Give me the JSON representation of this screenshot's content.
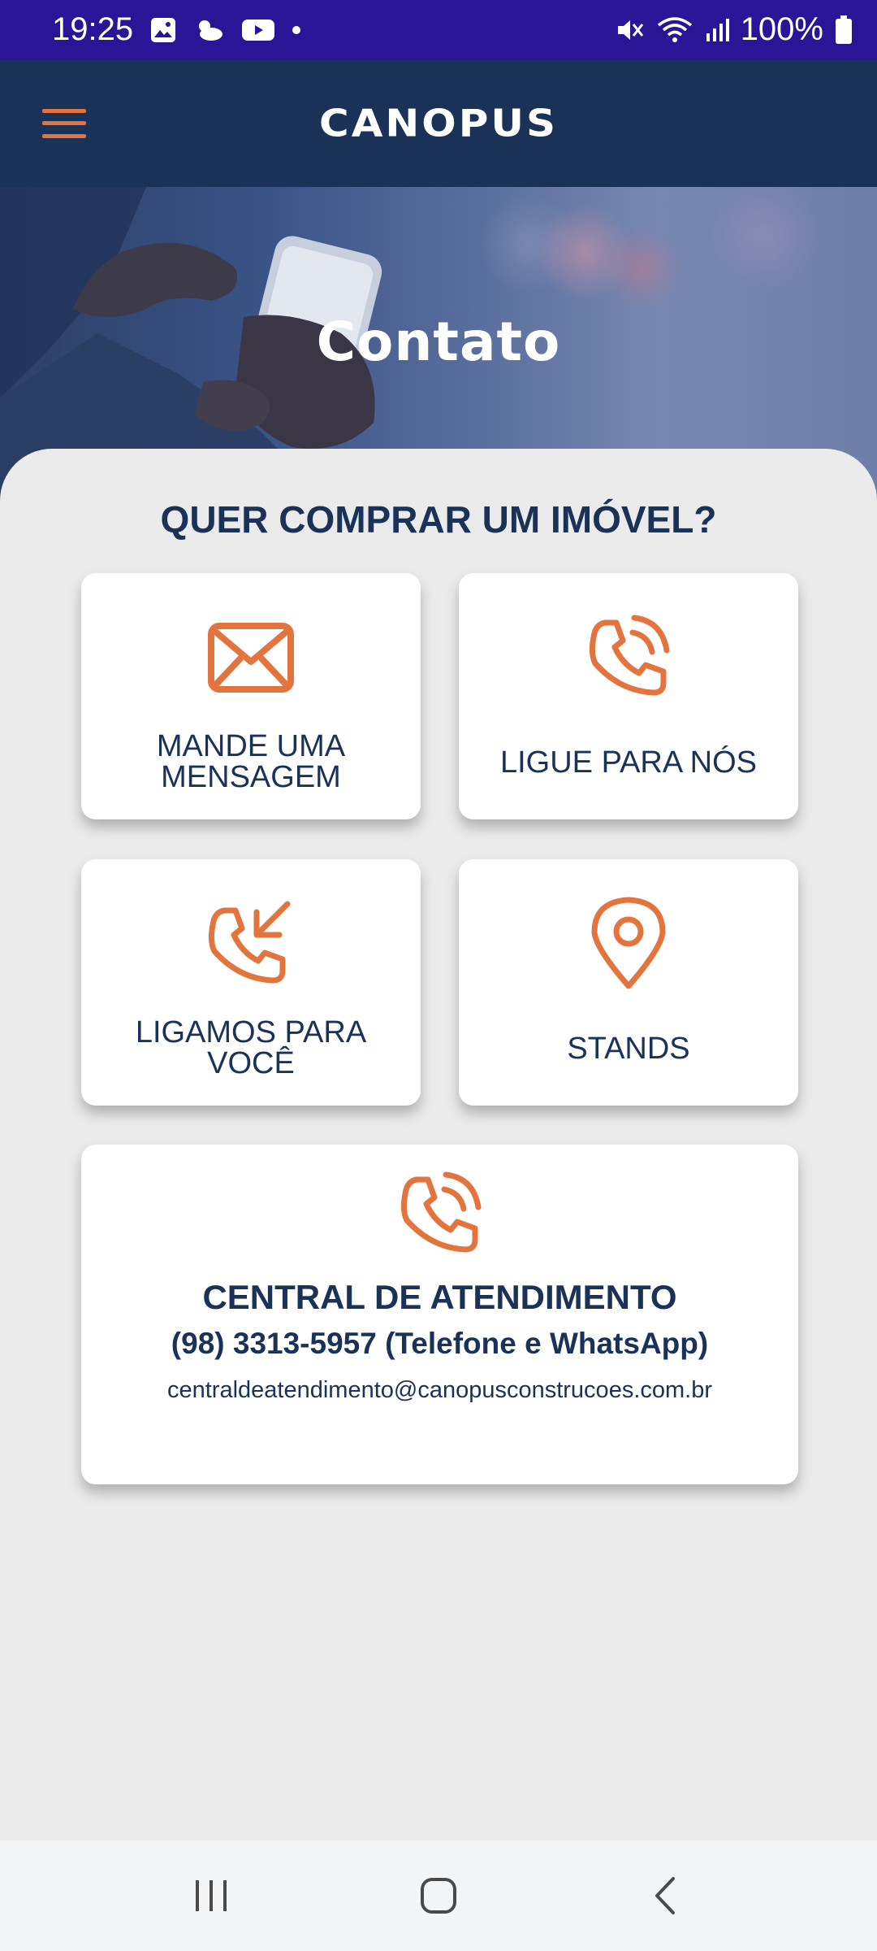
{
  "status_bar": {
    "time": "19:25",
    "battery": "100%",
    "left_icons": [
      "gallery-icon",
      "weather-icon",
      "youtube-icon",
      "dot-icon"
    ],
    "right_icons": [
      "mute-icon",
      "wifi-icon",
      "signal-icon",
      "battery-icon"
    ]
  },
  "header": {
    "brand": "CANOPUS",
    "menu_icon": "hamburger-menu-icon"
  },
  "hero": {
    "title": "Contato"
  },
  "main": {
    "heading": "QUER COMPRAR UM IMÓVEL?",
    "cards": [
      {
        "label": "MANDE UMA MENSAGEM",
        "icon": "envelope-icon"
      },
      {
        "label": "LIGUE PARA NÓS",
        "icon": "phone-ringing-icon"
      },
      {
        "label": "LIGAMOS PARA VOCÊ",
        "icon": "incoming-call-icon"
      },
      {
        "label": "STANDS",
        "icon": "map-pin-icon"
      }
    ],
    "central": {
      "icon": "phone-ringing-icon",
      "title": "CENTRAL DE ATENDIMENTO",
      "phone": "(98) 3313-5957 (Telefone e WhatsApp)",
      "email": "centraldeatendimento@canopusconstrucoes.com.br"
    }
  },
  "nav_bar": {
    "icons": [
      "recent-apps-icon",
      "home-icon",
      "back-icon"
    ]
  },
  "colors": {
    "status_bar": "#2a1596",
    "header": "#1b3258",
    "accent": "#e4743e",
    "text_primary": "#1b3258",
    "background": "#ebebeb"
  }
}
